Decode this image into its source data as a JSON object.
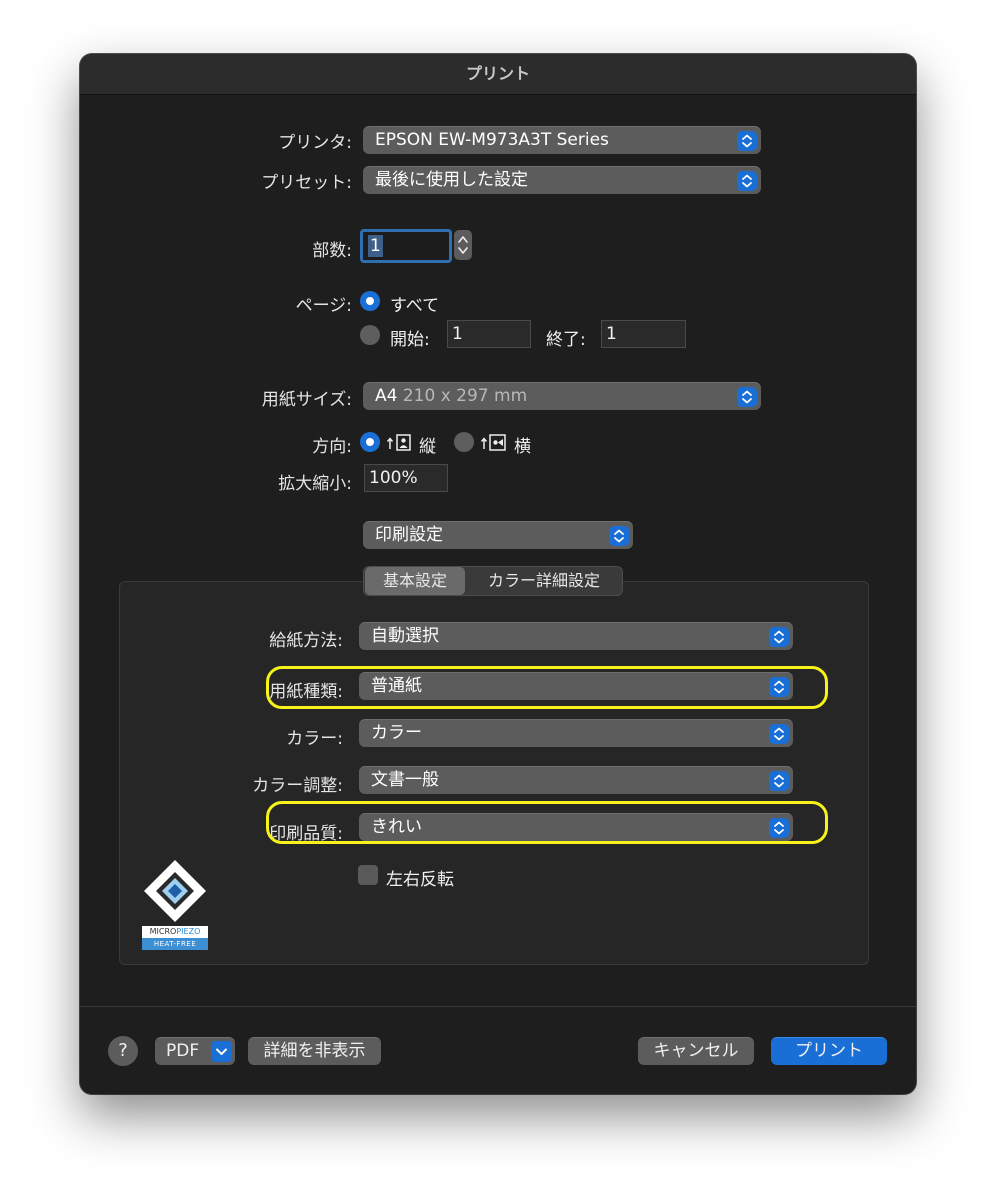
{
  "dialog": {
    "title": "プリント"
  },
  "printer": {
    "label": "プリンタ:",
    "value": "EPSON EW-M973A3T Series"
  },
  "preset": {
    "label": "プリセット:",
    "value": "最後に使用した設定"
  },
  "copies": {
    "label": "部数:",
    "value": "1"
  },
  "pages": {
    "label": "ページ:",
    "all_label": "すべて",
    "from_label": "開始:",
    "from_value": "1",
    "to_label": "終了:",
    "to_value": "1"
  },
  "paper_size": {
    "label": "用紙サイズ:",
    "name": "A4",
    "dims": "210 x 297 mm"
  },
  "orientation": {
    "label": "方向:",
    "portrait": "縦",
    "landscape": "横"
  },
  "scale": {
    "label": "拡大縮小:",
    "value": "100%"
  },
  "section_popup": {
    "value": "印刷設定"
  },
  "tabs": [
    {
      "label": "基本設定"
    },
    {
      "label": "カラー詳細設定"
    }
  ],
  "settings": {
    "paper_source": {
      "label": "給紙方法:",
      "value": "自動選択"
    },
    "media_type": {
      "label": "用紙種類:",
      "value": "普通紙"
    },
    "color": {
      "label": "カラー:",
      "value": "カラー"
    },
    "color_adjust": {
      "label": "カラー調整:",
      "value": "文書一般"
    },
    "quality": {
      "label": "印刷品質:",
      "value": "きれい"
    },
    "mirror": {
      "label": "左右反転"
    }
  },
  "logo": {
    "line1a": "MICRO",
    "line1b": "PIEZO",
    "line2": "HEAT-FREE"
  },
  "footer": {
    "help": "?",
    "pdf": "PDF",
    "hide_details": "詳細を非表示",
    "cancel": "キャンセル",
    "print": "プリント"
  },
  "colors": {
    "accent": "#1a6fd6",
    "highlight": "#f6f21a",
    "window": "#1e1e1e"
  }
}
